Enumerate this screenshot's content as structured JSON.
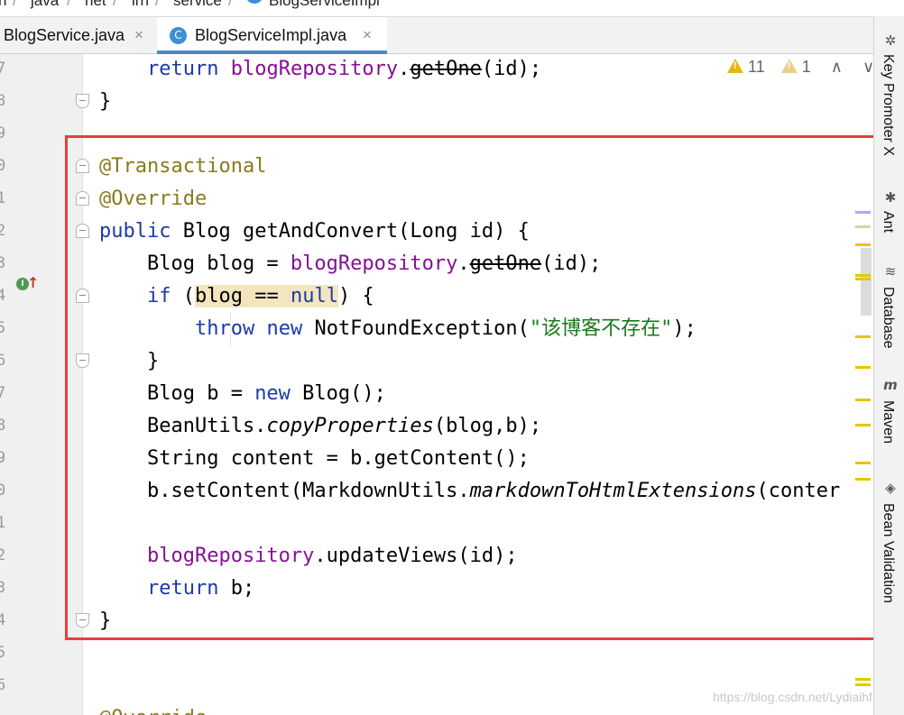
{
  "breadcrumb": {
    "items": [
      "n",
      "java",
      "net",
      "lrn",
      "service",
      "BlogServiceImpl"
    ],
    "separator": "/"
  },
  "tabs": [
    {
      "label": "BlogService.java",
      "close": "×",
      "active": false
    },
    {
      "label": "BlogServiceImpl.java",
      "close": "×",
      "active": true,
      "icon": "C"
    }
  ],
  "gutter": {
    "line_numbers": [
      "7",
      "8",
      "9",
      "0",
      "1",
      "2",
      "3",
      "4",
      "5",
      "6",
      "7",
      "8",
      "9",
      "0",
      "1",
      "2",
      "3",
      "4",
      "5",
      "6"
    ],
    "impl_icon": "I",
    "impl_arrow": "↑"
  },
  "inspection": {
    "warnings": "11",
    "weak_warnings": "1",
    "up": "∧",
    "down": "∨"
  },
  "code": {
    "l1_indent": "    ",
    "l1_kw": "return",
    "l1_sp": " ",
    "l1_field": "blogRepository",
    "l1_dot": ".",
    "l1_m": "getOne",
    "l1_rest": "(id);",
    "l2": "}",
    "l4": "@Transactional",
    "l5": "@Override",
    "l6_kw": "public",
    "l6_rest": " Blog getAndConvert(Long id) {",
    "l7_a": "    Blog blog = ",
    "l7_field": "blogRepository",
    "l7_dot": ".",
    "l7_m": "getOne",
    "l7_rest": "(id);",
    "l8_indent": "    ",
    "l8_kw": "if",
    "l8_a": " (",
    "l8_hl1": "blog == ",
    "l8_hl2": "null",
    "l8_rest": ") {",
    "l9_indent": "        ",
    "l9_kw1": "throw",
    "l9_sp": " ",
    "l9_kw2": "new",
    "l9_a": " NotFoundException(",
    "l9_str": "\"该博客不存在\"",
    "l9_rest": ");",
    "l10": "    }",
    "l11_a": "    Blog b = ",
    "l11_kw": "new",
    "l11_rest": " Blog();",
    "l12_a": "    BeanUtils.",
    "l12_it": "copyProperties",
    "l12_rest": "(blog,b);",
    "l13": "    String content = b.getContent();",
    "l14_a": "    b.setContent(MarkdownUtils.",
    "l14_it": "markdownToHtmlExtensions",
    "l14_rest": "(conter",
    "l16_indent": "    ",
    "l16_field": "blogRepository",
    "l16_rest": ".updateViews(id);",
    "l17_indent": "    ",
    "l17_kw": "return",
    "l17_rest": " b;",
    "l18": "}",
    "l21": "@Override"
  },
  "right_tools": [
    {
      "label": "Key Promoter X",
      "icon": "key-promoter-icon"
    },
    {
      "label": "Ant",
      "icon": "ant-icon"
    },
    {
      "label": "Database",
      "icon": "database-icon"
    },
    {
      "label": "Maven",
      "icon": "maven-icon"
    },
    {
      "label": "Bean Validation",
      "icon": "bean-validation-icon"
    }
  ],
  "watermark": "https://blog.csdn.net/Lydiaihf",
  "colors": {
    "highlight_box": "#e83e3e",
    "keyword": "#1c3aa9",
    "annotation": "#8a7a1c",
    "field": "#871094",
    "string": "#1a7a1a",
    "warning": "#e8b517"
  }
}
